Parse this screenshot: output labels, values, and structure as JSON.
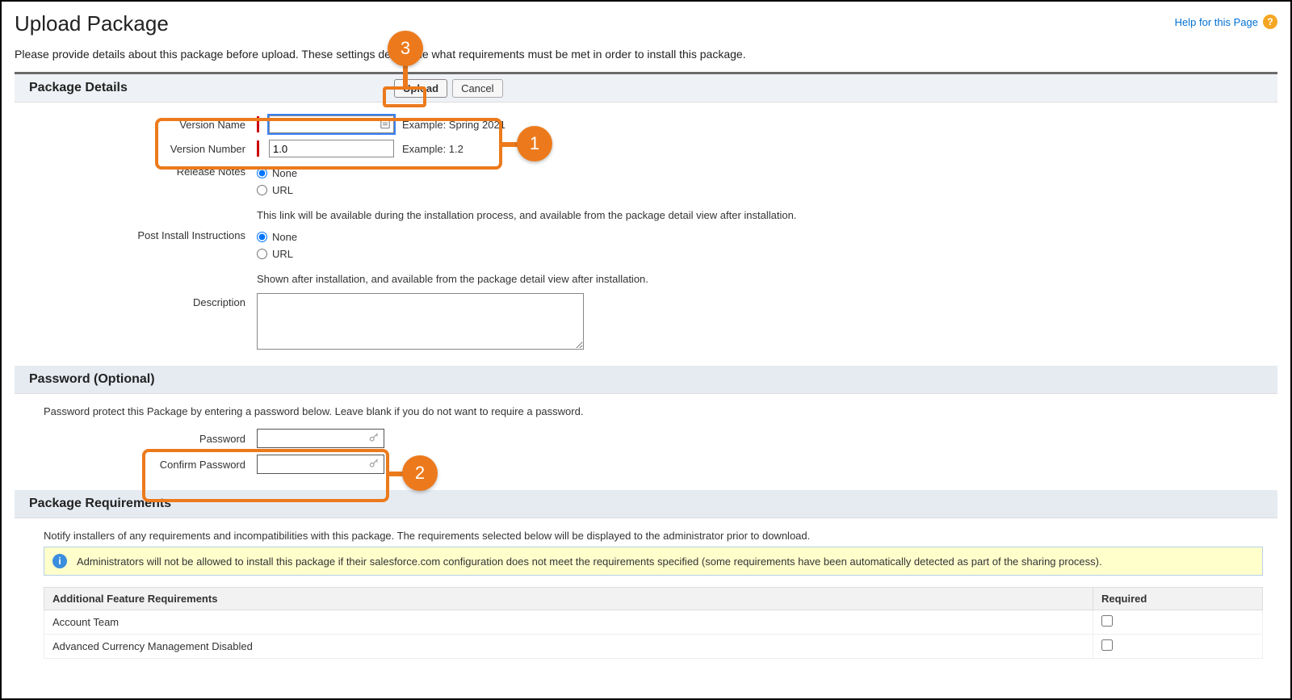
{
  "header": {
    "title": "Upload Package",
    "help_link": "Help for this Page",
    "intro": "Please provide details about this package before upload. These settings determine what requirements must be met in order to install this package."
  },
  "details": {
    "section_title": "Package Details",
    "upload_btn": "Upload",
    "cancel_btn": "Cancel",
    "version_name_label": "Version Name",
    "version_name_value": "",
    "version_name_hint": "Example: Spring 2021",
    "version_number_label": "Version Number",
    "version_number_value": "1.0",
    "version_number_hint": "Example: 1.2",
    "release_notes_label": "Release Notes",
    "release_notes_option_none": "None",
    "release_notes_option_url": "URL",
    "release_notes_selected": "None",
    "release_notes_note": "This link will be available during the installation process, and available from the package detail view after installation.",
    "post_install_label": "Post Install Instructions",
    "post_install_option_none": "None",
    "post_install_option_url": "URL",
    "post_install_selected": "None",
    "post_install_note": "Shown after installation, and available from the package detail view after installation.",
    "description_label": "Description",
    "description_value": ""
  },
  "password": {
    "section_title": "Password (Optional)",
    "note": "Password protect this Package by entering a password below. Leave blank if you do not want to require a password.",
    "password_label": "Password",
    "password_value": "",
    "confirm_label": "Confirm Password",
    "confirm_value": ""
  },
  "requirements": {
    "section_title": "Package Requirements",
    "note": "Notify installers of any requirements and incompatibilities with this package. The requirements selected below will be displayed to the administrator prior to download.",
    "banner": "Administrators will not be allowed to install this package if their salesforce.com configuration does not meet the requirements specified (some requirements have been automatically detected as part of the sharing process).",
    "col_feature": "Additional Feature Requirements",
    "col_required": "Required",
    "rows": [
      {
        "feature": "Account Team",
        "required": false
      },
      {
        "feature": "Advanced Currency Management Disabled",
        "required": false
      }
    ]
  },
  "annotations": {
    "b1": "1",
    "b2": "2",
    "b3": "3"
  }
}
